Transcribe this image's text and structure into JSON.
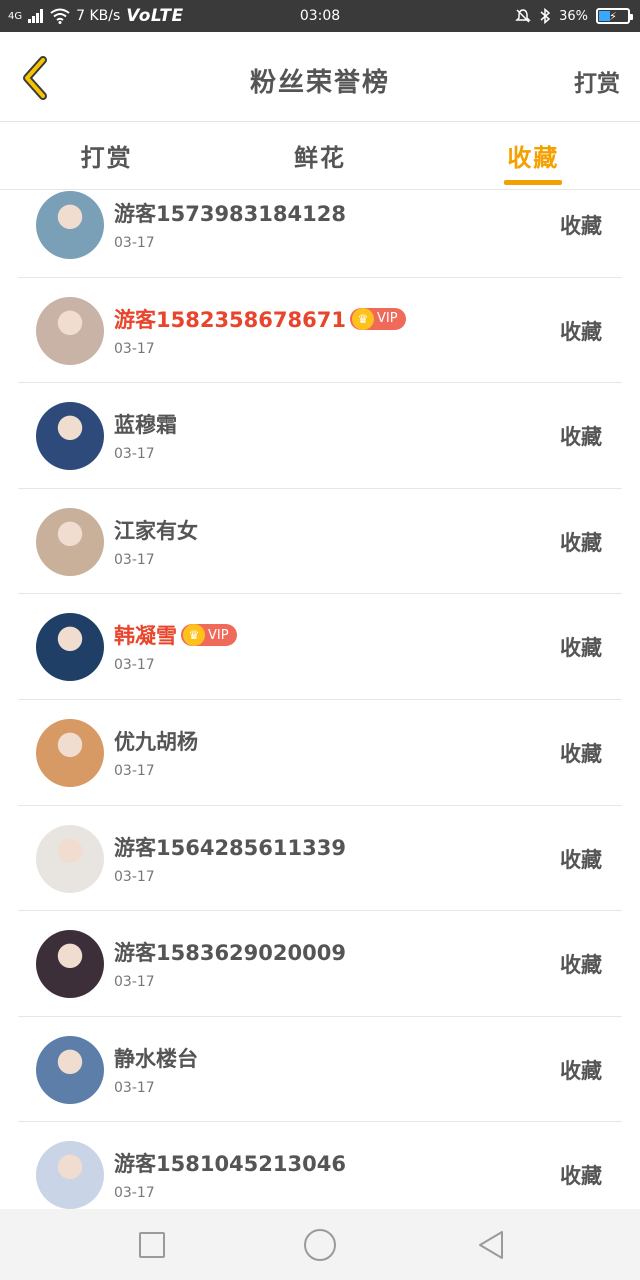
{
  "status_bar": {
    "network": "4G",
    "speed": "7 KB/s",
    "volte": "VoLTE",
    "time": "03:08",
    "battery": "36%",
    "battery_level": 0.36
  },
  "header": {
    "title": "粉丝荣誉榜",
    "action_label": "打赏"
  },
  "tabs": [
    {
      "label": "打赏",
      "active": false
    },
    {
      "label": "鲜花",
      "active": false
    },
    {
      "label": "收藏",
      "active": true
    }
  ],
  "vip_label": "VIP",
  "rows": [
    {
      "name": "游客1573983184128",
      "date": "03-17",
      "vip": false,
      "action": "收藏",
      "avatar_color": "#7aa0b8"
    },
    {
      "name": "游客1582358678671",
      "date": "03-17",
      "vip": true,
      "action": "收藏",
      "avatar_color": "#c9b3a6"
    },
    {
      "name": "蓝穆霜",
      "date": "03-17",
      "vip": false,
      "action": "收藏",
      "avatar_color": "#2e4a7a"
    },
    {
      "name": "江家有女",
      "date": "03-17",
      "vip": false,
      "action": "收藏",
      "avatar_color": "#c8b09a"
    },
    {
      "name": "韩凝雪",
      "date": "03-17",
      "vip": true,
      "action": "收藏",
      "avatar_color": "#1f3f66"
    },
    {
      "name": "优九胡杨",
      "date": "03-17",
      "vip": false,
      "action": "收藏",
      "avatar_color": "#d89a64"
    },
    {
      "name": "游客1564285611339",
      "date": "03-17",
      "vip": false,
      "action": "收藏",
      "avatar_color": "#e8e4e0"
    },
    {
      "name": "游客1583629020009",
      "date": "03-17",
      "vip": false,
      "action": "收藏",
      "avatar_color": "#3c2f3a"
    },
    {
      "name": "静水楼台",
      "date": "03-17",
      "vip": false,
      "action": "收藏",
      "avatar_color": "#5d7ea8"
    },
    {
      "name": "游客1581045213046",
      "date": "03-17",
      "vip": false,
      "action": "收藏",
      "avatar_color": "#c9d4e6"
    }
  ],
  "icons": {
    "back": "back-chevron-icon",
    "nav_recent": "square-icon",
    "nav_home": "circle-icon",
    "nav_back": "triangle-back-icon"
  },
  "colors": {
    "accent": "#f4a000",
    "vip_name": "#e8452c",
    "vip_badge": "#f06a5a",
    "crown": "#ffc21a"
  }
}
